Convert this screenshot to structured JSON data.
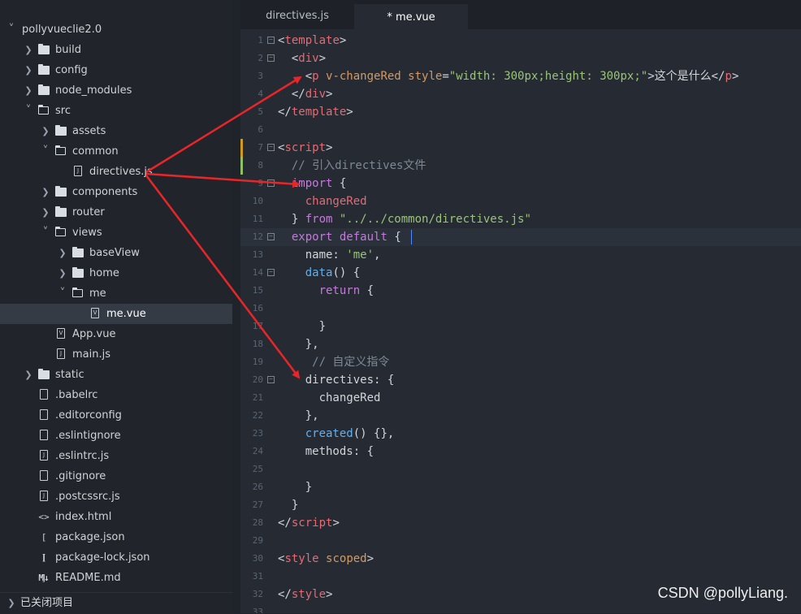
{
  "tree": [
    {
      "label": "pollyvueclie2.0",
      "type": "folder",
      "open": true,
      "depth": 0
    },
    {
      "label": "build",
      "type": "folder",
      "open": false,
      "depth": 1
    },
    {
      "label": "config",
      "type": "folder",
      "open": false,
      "depth": 1
    },
    {
      "label": "node_modules",
      "type": "folder",
      "open": false,
      "depth": 1
    },
    {
      "label": "src",
      "type": "folder",
      "open": true,
      "depth": 1
    },
    {
      "label": "assets",
      "type": "folder",
      "open": false,
      "depth": 2
    },
    {
      "label": "common",
      "type": "folder",
      "open": true,
      "depth": 2
    },
    {
      "label": "directives.js",
      "type": "js",
      "depth": 3
    },
    {
      "label": "components",
      "type": "folder",
      "open": false,
      "depth": 2
    },
    {
      "label": "router",
      "type": "folder",
      "open": false,
      "depth": 2
    },
    {
      "label": "views",
      "type": "folder",
      "open": true,
      "depth": 2
    },
    {
      "label": "baseView",
      "type": "folder",
      "open": false,
      "depth": 3
    },
    {
      "label": "home",
      "type": "folder",
      "open": false,
      "depth": 3
    },
    {
      "label": "me",
      "type": "folder",
      "open": true,
      "depth": 3
    },
    {
      "label": "me.vue",
      "type": "vue",
      "depth": 4,
      "selected": true
    },
    {
      "label": "App.vue",
      "type": "vue",
      "depth": 2
    },
    {
      "label": "main.js",
      "type": "js",
      "depth": 2
    },
    {
      "label": "static",
      "type": "folder",
      "open": false,
      "depth": 1
    },
    {
      "label": ".babelrc",
      "type": "file",
      "depth": 1
    },
    {
      "label": ".editorconfig",
      "type": "file",
      "depth": 1
    },
    {
      "label": ".eslintignore",
      "type": "file",
      "depth": 1
    },
    {
      "label": ".eslintrc.js",
      "type": "js",
      "depth": 1
    },
    {
      "label": ".gitignore",
      "type": "file",
      "depth": 1
    },
    {
      "label": ".postcssrc.js",
      "type": "js",
      "depth": 1
    },
    {
      "label": "index.html",
      "type": "html",
      "depth": 1
    },
    {
      "label": "package.json",
      "type": "json",
      "depth": 1
    },
    {
      "label": "package-lock.json",
      "type": "json",
      "depth": 1
    },
    {
      "label": "README.md",
      "type": "md",
      "depth": 1
    }
  ],
  "closed_projects_label": "已关闭项目",
  "tabs": [
    {
      "label": "directives.js",
      "active": false
    },
    {
      "label": "* me.vue",
      "active": true
    }
  ],
  "code_lines": [
    {
      "n": "1",
      "fold": true,
      "tokens": [
        [
          "<",
          "t-plain"
        ],
        [
          "template",
          "t-tag"
        ],
        [
          ">",
          "t-plain"
        ]
      ]
    },
    {
      "n": "2",
      "fold": true,
      "tokens": [
        [
          "  <",
          "t-plain"
        ],
        [
          "div",
          "t-tag"
        ],
        [
          ">",
          "t-plain"
        ]
      ]
    },
    {
      "n": "3",
      "tokens": [
        [
          "    <",
          "t-plain"
        ],
        [
          "p",
          "t-tag"
        ],
        [
          " v-changeRed ",
          "t-attr"
        ],
        [
          "style",
          "t-attr"
        ],
        [
          "=",
          "t-plain"
        ],
        [
          "\"width: 300px;height: 300px;\"",
          "t-str"
        ],
        [
          ">这个是什么</",
          "t-plain"
        ],
        [
          "p",
          "t-tag"
        ],
        [
          ">",
          "t-plain"
        ]
      ]
    },
    {
      "n": "4",
      "tokens": [
        [
          "  </",
          "t-plain"
        ],
        [
          "div",
          "t-tag"
        ],
        [
          ">",
          "t-plain"
        ]
      ]
    },
    {
      "n": "5",
      "tokens": [
        [
          "</",
          "t-plain"
        ],
        [
          "template",
          "t-tag"
        ],
        [
          ">",
          "t-plain"
        ]
      ]
    },
    {
      "n": "6",
      "tokens": []
    },
    {
      "n": "7",
      "fold": true,
      "tokens": [
        [
          "<",
          "t-plain"
        ],
        [
          "script",
          "t-tag"
        ],
        [
          ">",
          "t-plain"
        ]
      ]
    },
    {
      "n": "8",
      "tokens": [
        [
          "  // 引入directives文件",
          "t-com"
        ]
      ]
    },
    {
      "n": "9",
      "fold": true,
      "tokens": [
        [
          "  ",
          "t-plain"
        ],
        [
          "import",
          "t-kw"
        ],
        [
          " {",
          "t-plain"
        ]
      ]
    },
    {
      "n": "10",
      "tokens": [
        [
          "    ",
          "t-plain"
        ],
        [
          "changeRed",
          "t-var"
        ]
      ]
    },
    {
      "n": "11",
      "tokens": [
        [
          "  } ",
          "t-plain"
        ],
        [
          "from",
          "t-kw"
        ],
        [
          " ",
          "t-plain"
        ],
        [
          "\"../../common/directives.js\"",
          "t-str"
        ]
      ]
    },
    {
      "n": "12",
      "fold": true,
      "cur": true,
      "tokens": [
        [
          "  ",
          "t-plain"
        ],
        [
          "export",
          "t-kw"
        ],
        [
          " ",
          "t-plain"
        ],
        [
          "default",
          "t-kw"
        ],
        [
          " {",
          "t-plain"
        ]
      ]
    },
    {
      "n": "13",
      "tokens": [
        [
          "    name: ",
          "t-plain"
        ],
        [
          "'me'",
          "t-str"
        ],
        [
          ",",
          "t-plain"
        ]
      ]
    },
    {
      "n": "14",
      "fold": true,
      "tokens": [
        [
          "    ",
          "t-plain"
        ],
        [
          "data",
          "t-fn"
        ],
        [
          "() {",
          "t-plain"
        ]
      ]
    },
    {
      "n": "15",
      "tokens": [
        [
          "      ",
          "t-plain"
        ],
        [
          "return",
          "t-kw"
        ],
        [
          " {",
          "t-plain"
        ]
      ]
    },
    {
      "n": "16",
      "tokens": []
    },
    {
      "n": "17",
      "tokens": [
        [
          "      }",
          "t-plain"
        ]
      ]
    },
    {
      "n": "18",
      "tokens": [
        [
          "    },",
          "t-plain"
        ]
      ]
    },
    {
      "n": "19",
      "tokens": [
        [
          "     // 自定义指令",
          "t-com"
        ]
      ]
    },
    {
      "n": "20",
      "fold": true,
      "tokens": [
        [
          "    directives: {",
          "t-plain"
        ]
      ]
    },
    {
      "n": "21",
      "tokens": [
        [
          "      changeRed",
          "t-plain"
        ]
      ]
    },
    {
      "n": "22",
      "tokens": [
        [
          "    },",
          "t-plain"
        ]
      ]
    },
    {
      "n": "23",
      "tokens": [
        [
          "    ",
          "t-plain"
        ],
        [
          "created",
          "t-fn"
        ],
        [
          "() {},",
          "t-plain"
        ]
      ]
    },
    {
      "n": "24",
      "tokens": [
        [
          "    methods: {",
          "t-plain"
        ]
      ]
    },
    {
      "n": "25",
      "tokens": []
    },
    {
      "n": "26",
      "tokens": [
        [
          "    }",
          "t-plain"
        ]
      ]
    },
    {
      "n": "27",
      "tokens": [
        [
          "  }",
          "t-plain"
        ]
      ]
    },
    {
      "n": "28",
      "tokens": [
        [
          "</",
          "t-plain"
        ],
        [
          "script",
          "t-tag"
        ],
        [
          ">",
          "t-plain"
        ]
      ]
    },
    {
      "n": "29",
      "tokens": []
    },
    {
      "n": "30",
      "tokens": [
        [
          "<",
          "t-plain"
        ],
        [
          "style",
          "t-tag"
        ],
        [
          " ",
          "t-plain"
        ],
        [
          "scoped",
          "t-attr"
        ],
        [
          ">",
          "t-plain"
        ]
      ]
    },
    {
      "n": "31",
      "tokens": []
    },
    {
      "n": "32",
      "tokens": [
        [
          "</",
          "t-plain"
        ],
        [
          "style",
          "t-tag"
        ],
        [
          ">",
          "t-plain"
        ]
      ]
    },
    {
      "n": "33",
      "tokens": []
    }
  ],
  "watermark": "CSDN @pollyLiang.",
  "colors": {
    "sidebar_bg": "#21252b",
    "editor_bg": "#262b33",
    "selected_row": "#353b45",
    "arrow": "#e8262a",
    "git_modified": "#d19a1e",
    "git_added": "#8fbf6a"
  }
}
